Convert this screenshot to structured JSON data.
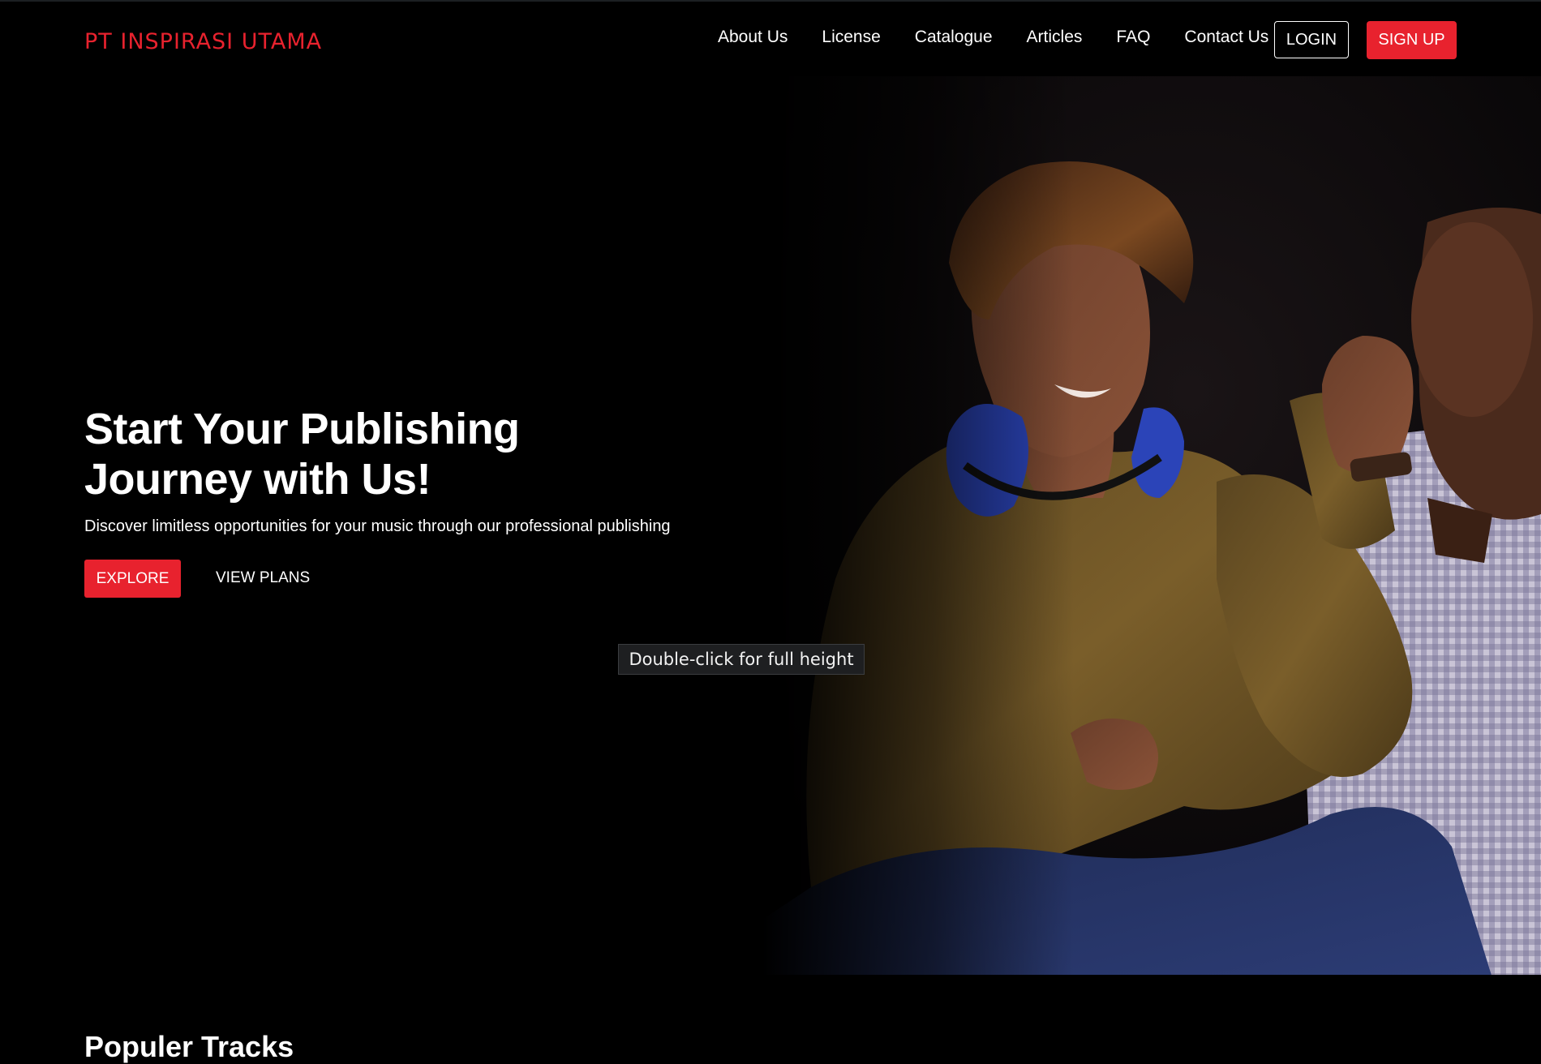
{
  "header": {
    "brand": "PT INSPIRASI UTAMA",
    "nav": [
      {
        "label": "About Us"
      },
      {
        "label": "License"
      },
      {
        "label": "Catalogue"
      },
      {
        "label": "Articles"
      },
      {
        "label": "FAQ"
      },
      {
        "label": "Contact Us"
      }
    ],
    "login_label": "LOGIN",
    "signup_label": "SIGN UP"
  },
  "hero": {
    "title": "Start Your Publishing Journey with Us!",
    "subtitle": "Discover limitless opportunities for your music through our professional publishing",
    "explore_label": "EXPLORE",
    "plans_label": "VIEW PLANS",
    "image": "hero-photo-people-with-headphones"
  },
  "overlay": {
    "tooltip": "Double-click for full height"
  },
  "tracks": {
    "title": "Populer Tracks"
  },
  "colors": {
    "accent": "#e8222e",
    "background": "#000000",
    "text": "#ffffff"
  }
}
